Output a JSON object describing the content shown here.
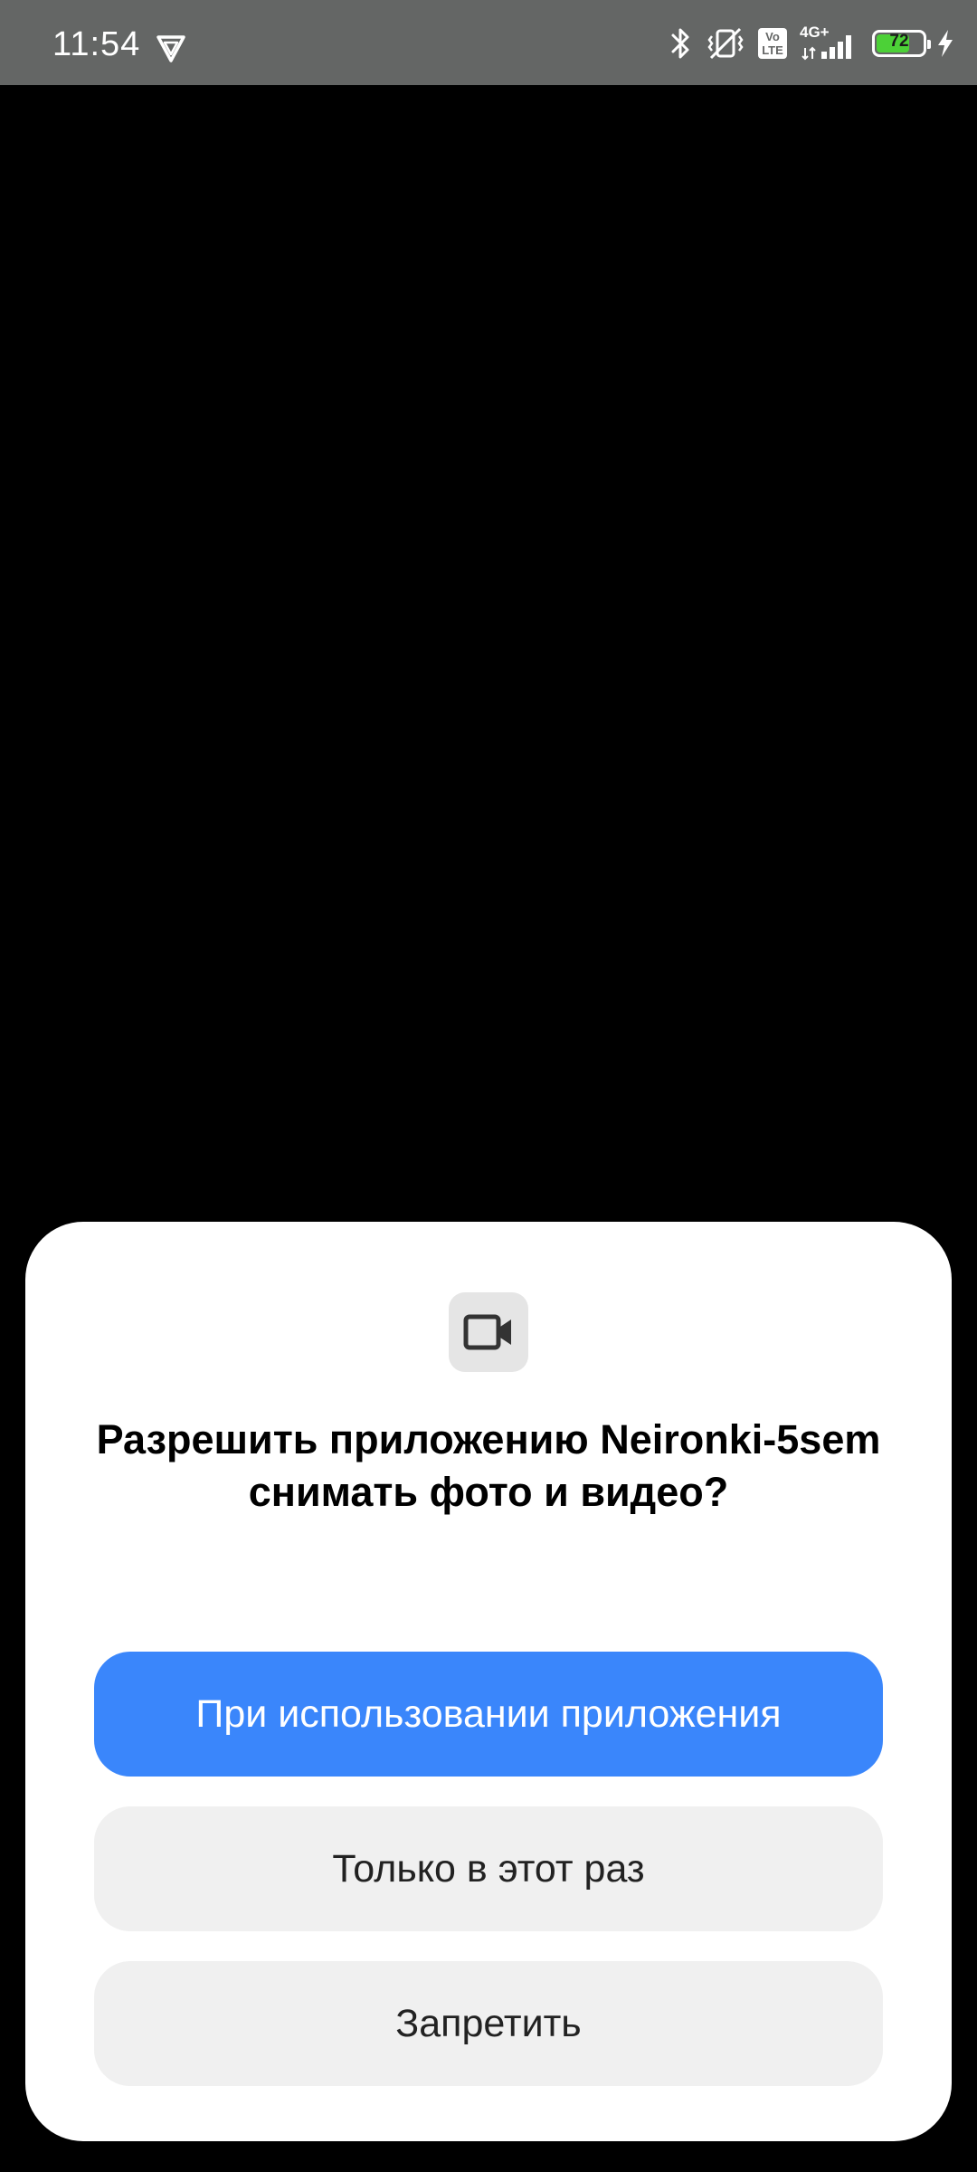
{
  "status_bar": {
    "time": "11:54",
    "network_type": "4G+",
    "volte_label_top": "Vo",
    "volte_label_bottom": "LTE",
    "battery_level": "72",
    "battery_fraction": 0.72,
    "background_color": "#646665",
    "icons": [
      "vpn-icon",
      "bluetooth-icon",
      "vibrate-mute-icon",
      "volte-icon",
      "signal-icon",
      "battery-icon",
      "charging-icon"
    ]
  },
  "dialog": {
    "icon": "video-camera-icon",
    "title": "Разрешить приложению Neironki-5sem снимать фото и видео?",
    "buttons": {
      "while_using": "При использовании приложения",
      "only_this_time": "Только в этот раз",
      "deny": "Запретить"
    },
    "colors": {
      "primary": "#3a86fb",
      "secondary": "#f0f0f0"
    }
  }
}
